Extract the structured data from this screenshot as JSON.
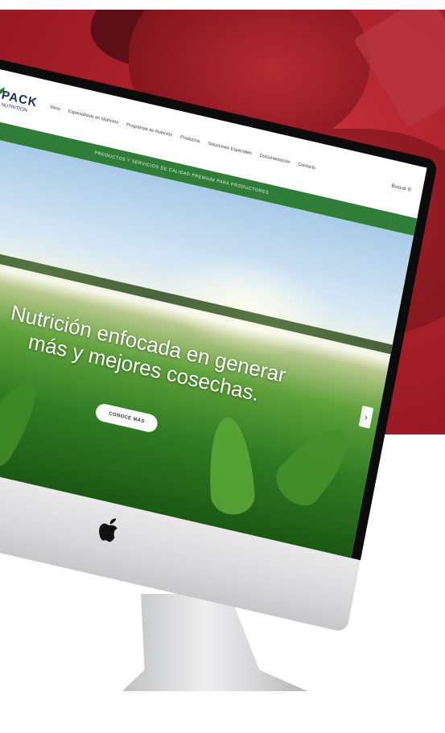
{
  "site": {
    "logo": {
      "name": "PACK",
      "sub": "NUTRITION"
    },
    "nav": [
      "Inicio",
      "Especialistas en Nutrición",
      "Programas de Nutrición",
      "Productos",
      "Soluciones Especiales",
      "Documentación",
      "Contacto"
    ],
    "search_label": "Buscar",
    "promo_text": "PRODUCTOS Y SERVICIOS DE CALIDAD PREMIUM PARA PRODUCTORES",
    "hero_line1": "Nutrición enfocada en generar",
    "hero_line2": "más y mejores cosechas.",
    "cta_label": "CONOCE MÁS",
    "next_arrow": "›"
  },
  "colors": {
    "brand_green": "#2f7d39",
    "logo_blue": "#1d2e63",
    "bg_red": "#a81f29"
  },
  "icons": [
    "apple-logo-icon",
    "search-icon",
    "chevron-right-icon",
    "checkmark-logo-icon"
  ]
}
